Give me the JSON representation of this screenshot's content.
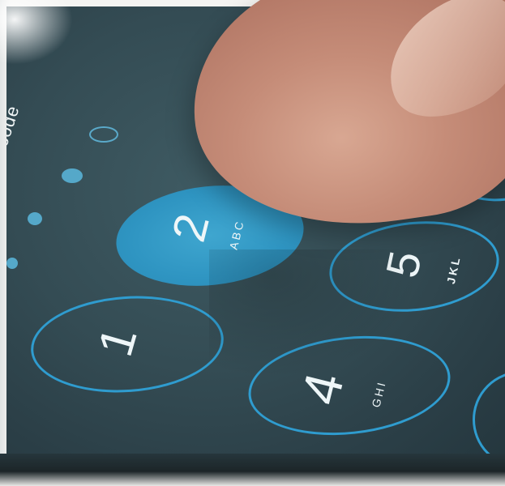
{
  "screen": {
    "title": "Passcode"
  },
  "keypad": {
    "keys": [
      {
        "digit": "2",
        "letters": "ABC",
        "state": "pressed"
      },
      {
        "digit": "5",
        "letters": "JKL"
      },
      {
        "digit": "1",
        "letters": ""
      },
      {
        "digit": "4",
        "letters": "GHI"
      }
    ]
  },
  "passcode_dots": {
    "filled": 3,
    "total": 4
  },
  "colors": {
    "key_ring": "#2f9ccf",
    "pressed_key": "#3fa6cf",
    "screen_background": "#344c54"
  }
}
